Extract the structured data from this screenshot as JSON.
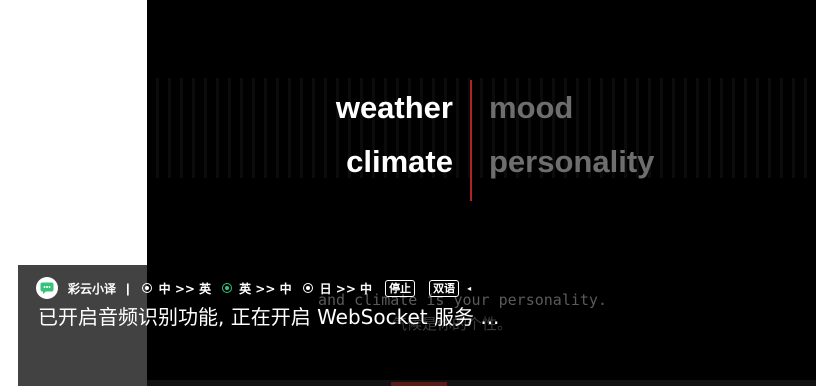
{
  "video": {
    "words_left": [
      "weather",
      "climate"
    ],
    "words_right": [
      "mood",
      "personality"
    ],
    "bg_caption_line1": "and climate is your personality.",
    "bg_caption_line2": "气候是你的个性。",
    "accent_divider": "#b42323"
  },
  "translator": {
    "app_name": "彩云小译",
    "separator": "|",
    "options": [
      {
        "label": "中 >> 英",
        "selected": false
      },
      {
        "label": "英 >> 中",
        "selected": true
      },
      {
        "label": "日 >> 中",
        "selected": false
      }
    ],
    "stop_label": "停止",
    "bilingual_label": "双语",
    "collapse_icon": "◂",
    "status": "已开启音频识别功能, 正在开启 WebSocket 服务 ...",
    "accent": "#35c27a"
  }
}
